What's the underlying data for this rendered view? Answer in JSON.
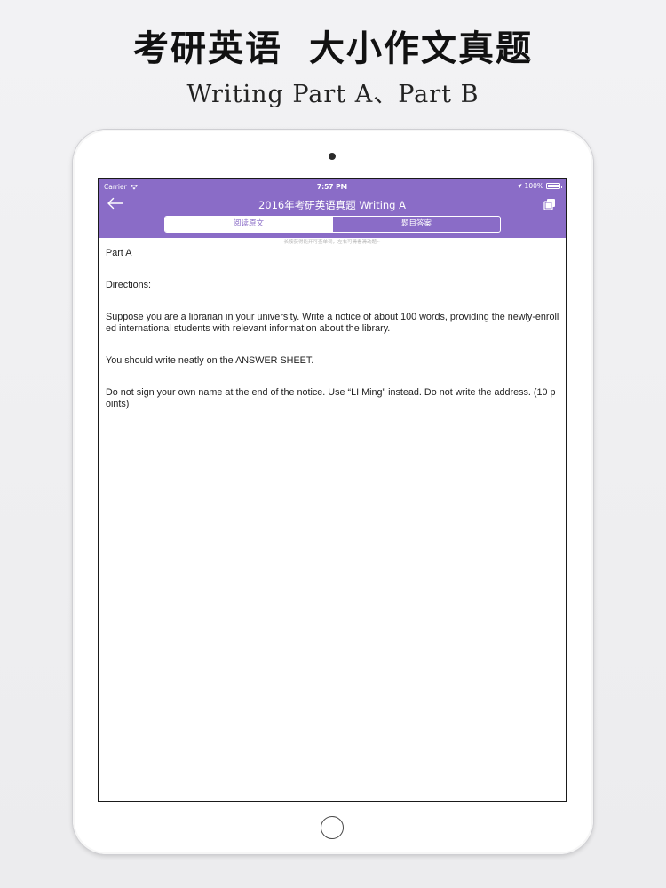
{
  "promo": {
    "title_left": "考研英语",
    "title_right": "大小作文真题",
    "subtitle": "Writing Part A、Part B"
  },
  "status_bar": {
    "carrier": "Carrier",
    "time": "7:57 PM",
    "battery": "100%",
    "battery_level": 1.0
  },
  "nav": {
    "title": "2016年考研英语真题 Writing A",
    "back_icon": "back-arrow-icon",
    "copy_icon": "copy-icon"
  },
  "tabs": [
    {
      "label": "阅读原文",
      "active": true
    },
    {
      "label": "题目答案",
      "active": false
    }
  ],
  "hint": "长按获得能开可查单词，左右可滑看滑动题~",
  "content": {
    "paragraphs": [
      "Part A",
      "Directions:",
      "Suppose you are a librarian in your university. Write a notice of about 100 words, providing the newly-enrolled international students with relevant information about the library.",
      "You should write neatly on the ANSWER SHEET.",
      "Do not sign your own name at the end of the notice. Use “LI Ming” instead. Do not write the address. (10 points)"
    ]
  },
  "colors": {
    "accent": "#8a6cc7",
    "text": "#222222",
    "hint": "#b5b5b5"
  }
}
